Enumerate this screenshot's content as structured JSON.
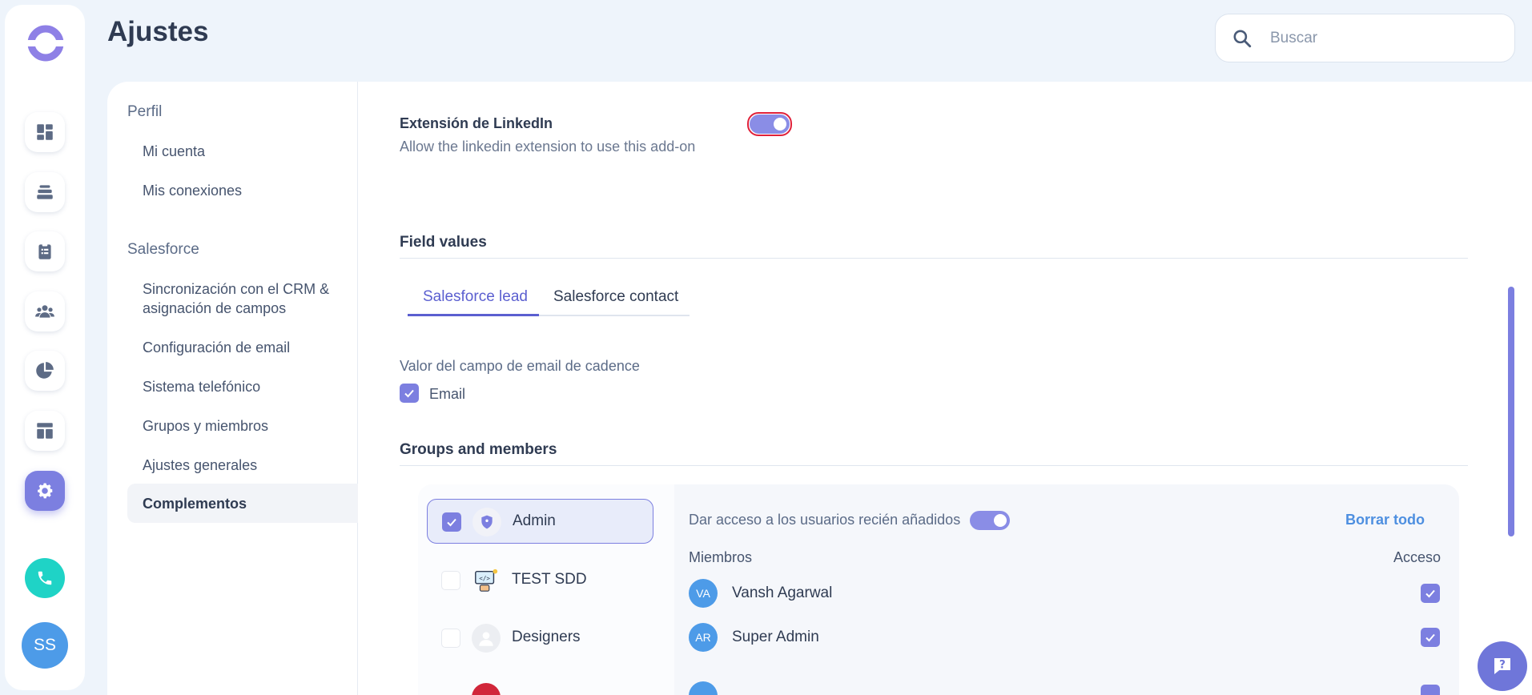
{
  "colors": {
    "accent": "#7c7fe0",
    "link": "#4d8fe0",
    "phone": "#1fd3c6",
    "avatar": "#4d9be8",
    "focus": "#e0213a"
  },
  "rail": {
    "icons": [
      "dashboard-icon",
      "stack-icon",
      "clipboard-icon",
      "people-icon",
      "pie-chart-icon",
      "layout-icon",
      "gear-icon"
    ],
    "phone_icon": "phone-icon",
    "user_initials": "SS"
  },
  "header": {
    "title": "Ajustes",
    "search_placeholder": "Buscar"
  },
  "nav": {
    "profile_section": "Perfil",
    "profile_items": [
      "Mi cuenta",
      "Mis conexiones"
    ],
    "salesforce_section": "Salesforce",
    "salesforce_items": [
      "Sincronización con el CRM & asignación de campos",
      "Configuración de email",
      "Sistema telefónico",
      "Grupos y miembros",
      "Ajustes generales",
      "Complementos"
    ]
  },
  "linkedin": {
    "title": "Extensión de LinkedIn",
    "description": "Allow the linkedin extension to use this add-on",
    "enabled": true
  },
  "field_values": {
    "title": "Field values",
    "tabs": [
      "Salesforce lead",
      "Salesforce contact"
    ],
    "active_tab": "Salesforce lead",
    "email_field_label": "Valor del campo de email de cadence",
    "email_option": "Email",
    "email_checked": true
  },
  "groups": {
    "title": "Groups and members",
    "list": [
      {
        "name": "Admin",
        "checked": true
      },
      {
        "name": "TEST SDD",
        "checked": false
      },
      {
        "name": "Designers",
        "checked": false
      }
    ],
    "new_users_access_label": "Dar acceso a los usuarios recién añadidos",
    "new_users_access": true,
    "clear_all": "Borrar todo",
    "members_header": "Miembros",
    "access_header": "Acceso",
    "members": [
      {
        "initials": "VA",
        "name": "Vansh Agarwal",
        "access": true
      },
      {
        "initials": "AR",
        "name": "Super Admin",
        "access": true
      }
    ]
  },
  "help": {
    "icon": "help-icon"
  }
}
